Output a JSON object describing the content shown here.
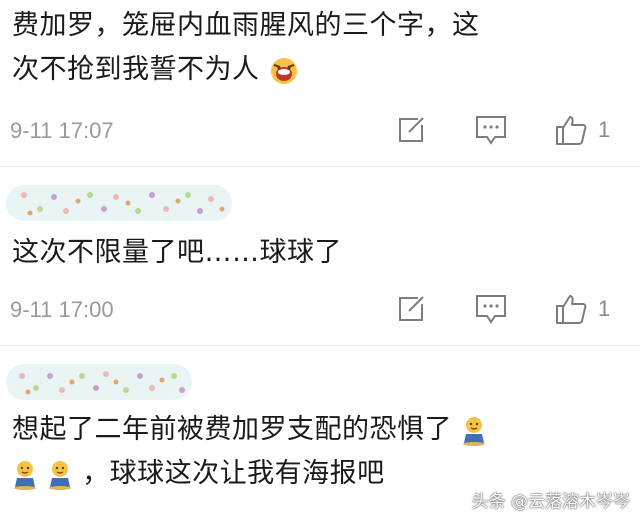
{
  "comments": [
    {
      "text_line1": "费加罗，笼屉内血雨腥风的三个字，这",
      "text_line2": "次不抢到我誓不为人",
      "emoji": "fearful-face-icon",
      "time": "9-11 17:07",
      "like_count": "1"
    },
    {
      "text": "这次不限量了吧……球球了",
      "time": "9-11 17:00",
      "like_count": "1"
    },
    {
      "text_line1": "想起了二年前被费加罗支配的恐惧了",
      "text_line2": "，球球这次让我有海报吧",
      "emoji": "kneeling-baby-icon"
    }
  ],
  "watermark": "头条 @云落溶木岑岑",
  "colors": {
    "meta_gray": "#9a9a9a",
    "divider": "#e6e6e6",
    "blur_bg": "#e9f4f4"
  }
}
